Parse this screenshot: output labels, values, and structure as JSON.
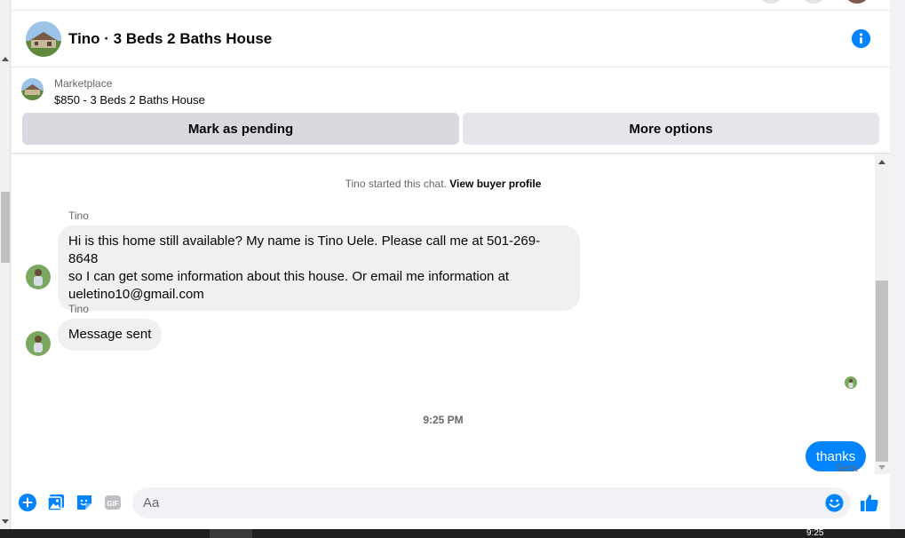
{
  "conversation": {
    "title": "Tino · 3 Beds 2 Baths House"
  },
  "marketplace": {
    "label": "Marketplace",
    "listing": "$850 - 3 Beds 2 Baths House",
    "mark_pending_label": "Mark as pending",
    "more_options_label": "More options"
  },
  "chat": {
    "system_prefix": "Tino started this chat.",
    "system_link": "View buyer profile",
    "messages": [
      {
        "sender": "Tino",
        "text_lines": [
          "Hi is this home still available? My name is Tino Uele. Please call me at 501-269-8648",
          "so I can get some information about this house. Or email me information at",
          "ueletino10@gmail.com"
        ]
      },
      {
        "sender": "Tino",
        "text": "Message sent"
      }
    ],
    "timestamp": "9:25 PM",
    "outgoing": {
      "text": "thanks",
      "status": "Sent"
    }
  },
  "composer": {
    "placeholder": "Aa"
  },
  "taskbar": {
    "time": "9:25"
  },
  "colors": {
    "accent": "#0084ff",
    "bubble_in": "#f0f0f0",
    "button_bg": "#e4e6eb"
  },
  "icons": {
    "info": "info-icon",
    "add": "plus-circle-icon",
    "gallery": "image-icon",
    "sticker": "sticker-icon",
    "gif": "gif-icon",
    "emoji": "emoji-icon",
    "like": "thumbs-up-icon"
  }
}
